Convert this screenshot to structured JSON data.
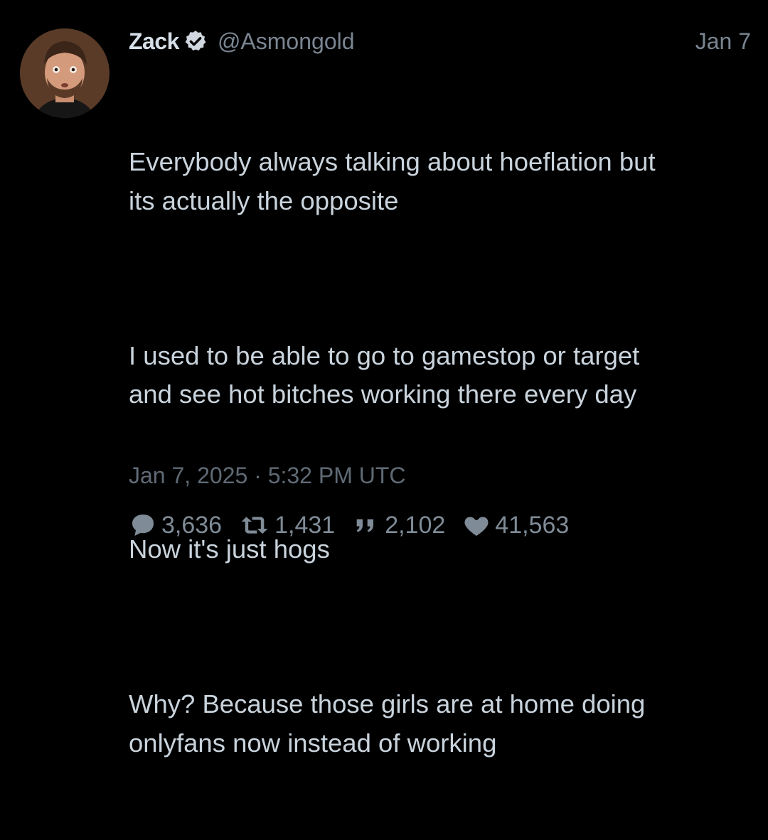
{
  "tweet": {
    "author": {
      "display_name": "Zack",
      "handle": "@Asmongold",
      "avatar_icon": "avatar-photo",
      "verified_icon": "verified-badge-icon"
    },
    "date_short": "Jan 7",
    "paragraphs": [
      "Everybody always talking about hoeflation but\nits actually the opposite",
      "I used to be able to go to gamestop or target\nand see hot bitches working there every day",
      "Now it's just hogs",
      "Why? Because those girls are at home doing\nonlyfans now instead of working"
    ],
    "timestamp": "Jan 7, 2025 · 5:32 PM UTC",
    "stats": {
      "replies": "3,636",
      "retweets": "1,431",
      "quotes": "2,102",
      "likes": "41,563"
    }
  },
  "colors": {
    "background": "#000000",
    "text": "#c9d3dc",
    "muted": "#7a8591",
    "verified_badge": "#d0d7de"
  }
}
